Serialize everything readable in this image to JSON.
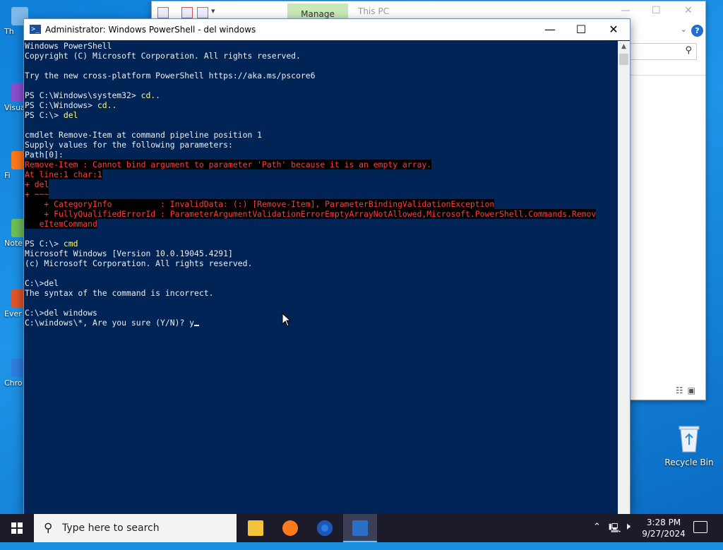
{
  "desktop": {
    "icons": [
      {
        "label": "Th",
        "color": "#7cb8e8"
      },
      {
        "label": "Visua",
        "color": "#8a4fd0"
      },
      {
        "label": "Fi",
        "color": "#ff7a1a"
      },
      {
        "label": "Note",
        "color": "#6fbf5a"
      },
      {
        "label": "Ever",
        "color": "#e0562a"
      },
      {
        "label": "Chro",
        "color": "#2f7de0"
      }
    ],
    "recycle_bin": {
      "label": "Recycle Bin"
    }
  },
  "explorer": {
    "manage_tab": "Manage",
    "title": "This PC"
  },
  "powershell": {
    "title": "Administrator: Windows PowerShell - del  windows",
    "lines": [
      {
        "t": "Windows PowerShell",
        "s": "n"
      },
      {
        "t": "Copyright (C) Microsoft Corporation. All rights reserved.",
        "s": "n"
      },
      {
        "t": "",
        "s": "n"
      },
      {
        "t": "Try the new cross-platform PowerShell https://aka.ms/pscore6",
        "s": "n"
      },
      {
        "t": "",
        "s": "n"
      },
      {
        "p": "PS C:\\Windows\\system32> ",
        "c": "cd..",
        "s": "p"
      },
      {
        "p": "PS C:\\Windows> ",
        "c": "cd..",
        "s": "p"
      },
      {
        "p": "PS C:\\> ",
        "c": "del",
        "s": "p"
      },
      {
        "t": "",
        "s": "n"
      },
      {
        "t": "cmdlet Remove-Item at command pipeline position 1",
        "s": "n"
      },
      {
        "t": "Supply values for the following parameters:",
        "s": "n"
      },
      {
        "t": "Path[0]:",
        "s": "n"
      },
      {
        "t": "Remove-Item : Cannot bind argument to parameter 'Path' because it is an empty array.",
        "s": "e"
      },
      {
        "t": "At line:1 char:1",
        "s": "e"
      },
      {
        "t": "+ del",
        "s": "e"
      },
      {
        "t": "+ ~~~",
        "s": "e"
      },
      {
        "t": "    + CategoryInfo          : InvalidData: (:) [Remove-Item], ParameterBindingValidationException",
        "s": "e"
      },
      {
        "t": "    + FullyQualifiedErrorId : ParameterArgumentValidationErrorEmptyArrayNotAllowed,Microsoft.PowerShell.Commands.Remov",
        "s": "e"
      },
      {
        "t": "   eItemCommand",
        "s": "e"
      },
      {
        "t": "",
        "s": "n"
      },
      {
        "p": "PS C:\\> ",
        "c": "cmd",
        "s": "p"
      },
      {
        "t": "Microsoft Windows [Version 10.0.19045.4291]",
        "s": "n"
      },
      {
        "t": "(c) Microsoft Corporation. All rights reserved.",
        "s": "n"
      },
      {
        "t": "",
        "s": "n"
      },
      {
        "t": "C:\\>del",
        "s": "n"
      },
      {
        "t": "The syntax of the command is incorrect.",
        "s": "n"
      },
      {
        "t": "",
        "s": "n"
      },
      {
        "t": "C:\\>del windows",
        "s": "n"
      },
      {
        "t": "C:\\windows\\*, Are you sure (Y/N)? y",
        "s": "c"
      }
    ]
  },
  "taskbar": {
    "search_placeholder": "Type here to search",
    "apps": [
      {
        "name": "file-explorer",
        "color": "#f3c33b"
      },
      {
        "name": "firefox",
        "color": "#ff7a1a"
      },
      {
        "name": "chrome",
        "color": "#2f7de0"
      },
      {
        "name": "powershell",
        "color": "#2b6fc9"
      }
    ],
    "time": "3:28 PM",
    "date": "9/27/2024"
  }
}
